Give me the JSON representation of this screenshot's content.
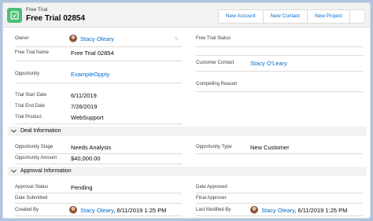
{
  "header": {
    "object_label": "Free Trial",
    "record_title": "Free Trial 02854",
    "actions": [
      "New Account",
      "New Contact",
      "New Project"
    ],
    "icon": "trial-icon"
  },
  "details": {
    "owner_label": "Owner",
    "owner_value": "Stacy Oleary",
    "free_trial_name_label": "Free Trial Name",
    "free_trial_name_value": "Free Trial 02854",
    "opportunity_label": "Opportunity",
    "opportunity_value": "ExampleOppty",
    "start_label": "Trial Start Date",
    "start_value": "6/11/2019",
    "end_label": "Trial End Date",
    "end_value": "7/26/2019",
    "product_label": "Trial Product",
    "product_value": "WebSupport",
    "status_label": "Free Trial Status",
    "status_value": "",
    "contact_label": "Customer Contact",
    "contact_value": "Stacy O'Leary",
    "reason_label": "Compelling Reason",
    "reason_value": ""
  },
  "deal": {
    "section_title": "Deal Information",
    "stage_label": "Opportunity Stage",
    "stage_value": "Needs Analysis",
    "amount_label": "Opportunity Amount",
    "amount_value": "$40,000.00",
    "type_label": "Opportunity Type",
    "type_value": "New Customer"
  },
  "approval": {
    "section_title": "Approval Information",
    "status_label": "Approval Status",
    "status_value": "Pending",
    "submitted_label": "Date Submitted",
    "approved_label": "Date Approved",
    "final_label": "Final Approver",
    "created_label": "Created By",
    "created_user": "Stacy Oleary",
    "created_date": ", 6/11/2019 1:25 PM",
    "modified_label": "Last Modified By",
    "modified_user": "Stacy Oleary",
    "modified_date": ", 6/11/2019 1:25 PM"
  },
  "colors": {
    "link": "#006dcc",
    "accent": "#4bc076",
    "background": "#b0c4df"
  }
}
